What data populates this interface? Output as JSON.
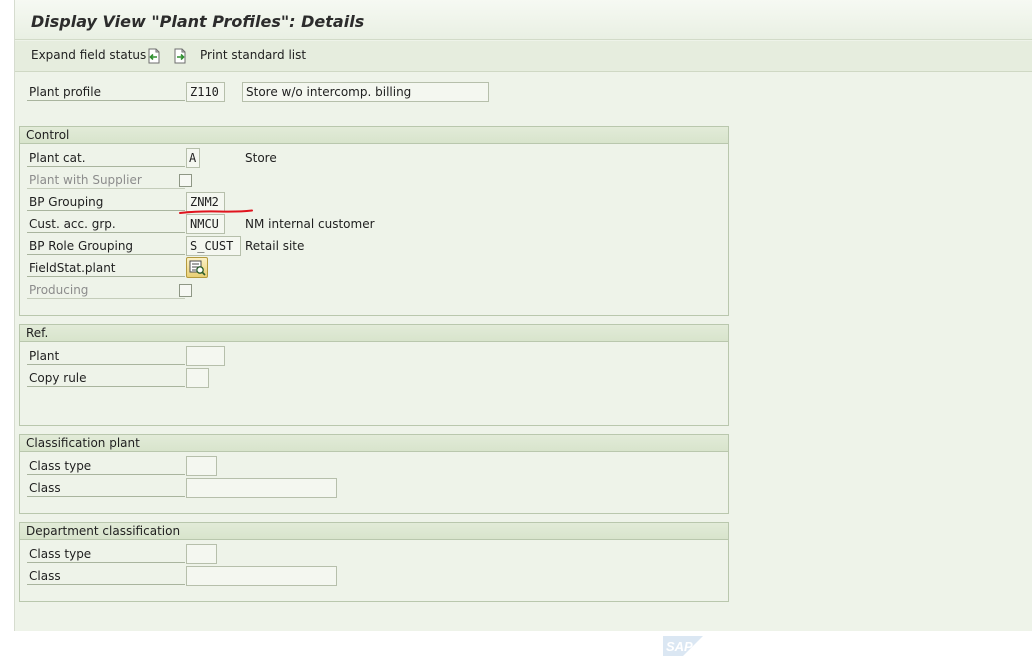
{
  "title": "Display View \"Plant Profiles\": Details",
  "toolbar": {
    "expand_label": "Expand field status",
    "icon1": "previous-entry-icon",
    "icon2": "next-entry-icon",
    "print_label": "Print standard list"
  },
  "header": {
    "plant_profile_label": "Plant profile",
    "plant_profile_value": "Z110",
    "plant_profile_desc": "Store w/o intercomp. billing"
  },
  "control": {
    "title": "Control",
    "plant_cat_label": "Plant cat.",
    "plant_cat_value": "A",
    "plant_cat_desc": "Store",
    "plant_supplier_label": "Plant with Supplier",
    "bp_grouping_label": "BP Grouping",
    "bp_grouping_value": "ZNM2",
    "cust_acc_grp_label": "Cust. acc. grp.",
    "cust_acc_grp_value": "NMCU",
    "cust_acc_grp_desc": "NM internal customer",
    "bp_role_label": "BP Role Grouping",
    "bp_role_value": "S_CUST",
    "bp_role_desc": "Retail site",
    "fieldstat_label": "FieldStat.plant",
    "producing_label": "Producing"
  },
  "ref": {
    "title": "Ref.",
    "plant_label": "Plant",
    "plant_value": "",
    "copy_rule_label": "Copy rule",
    "copy_rule_value": ""
  },
  "classification_plant": {
    "title": "Classification plant",
    "class_type_label": "Class type",
    "class_type_value": "",
    "class_label": "Class",
    "class_value": ""
  },
  "department_classification": {
    "title": "Department classification",
    "class_type_label": "Class type",
    "class_type_value": "",
    "class_label": "Class",
    "class_value": ""
  },
  "colors": {
    "background": "#eef3e9",
    "annotation_underline": "#e0141e",
    "group_header": "#dce7d1"
  },
  "footer_logo": "SAP"
}
